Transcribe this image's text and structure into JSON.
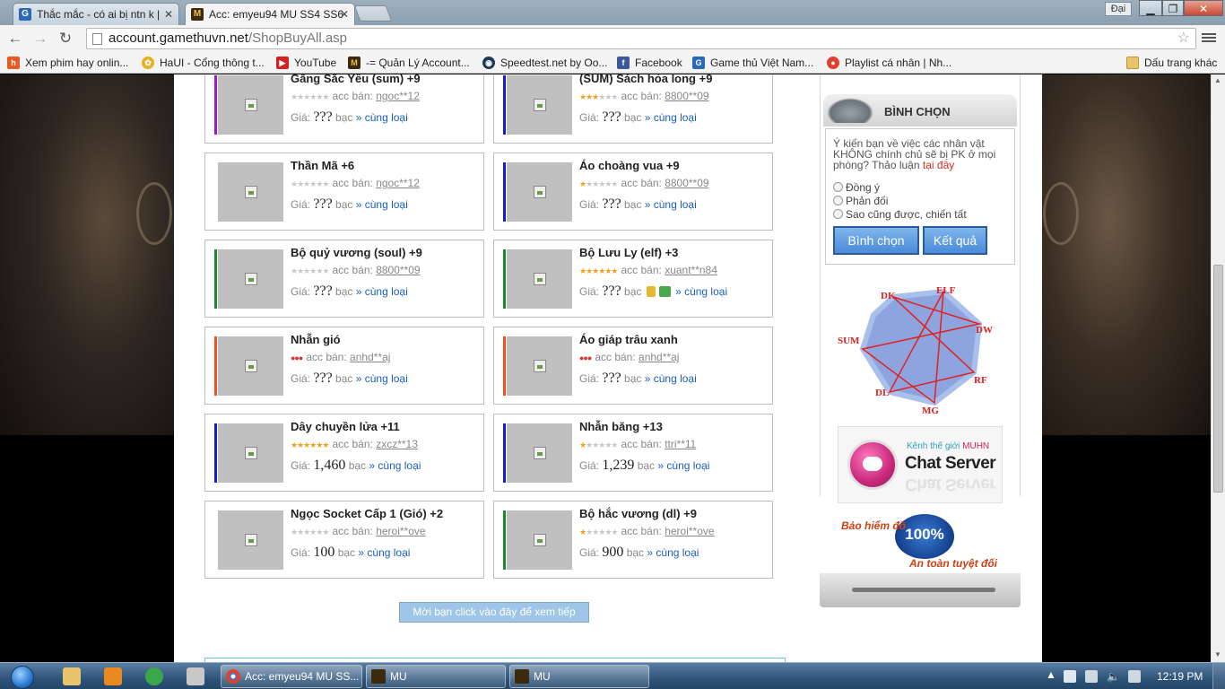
{
  "browser": {
    "tabs": [
      {
        "label": "Thắc mắc - có ai bị ntn k |",
        "active": false
      },
      {
        "label": "Acc: emyeu94 MU SS4 SS6",
        "active": true
      }
    ],
    "user_badge": "Đại",
    "url_host": "account.gamethuvn.net",
    "url_path": "/ShopBuyAll.asp",
    "bookmarks": [
      "Xem phim hay onlin...",
      "HaUI - Cổng thông t...",
      "YouTube",
      "-= Quản Lý Account...",
      "Speedtest.net by Oo...",
      "Facebook",
      "Game thủ Việt Nam...",
      "Playlist cá nhân | Nh...",
      "Dấu trang khác"
    ]
  },
  "items": [
    {
      "name": "Găng Sắc Yêu (sum) +9",
      "stars": 0,
      "seller": "ngoc**12",
      "price": "???",
      "accent": "#9a1ad0"
    },
    {
      "name": "(SUM) Sách hỏa long +9",
      "stars": 3,
      "seller": "8800**09",
      "price": "???",
      "accent": "#1020d0"
    },
    {
      "name": "Thần Mã +6",
      "stars": 0,
      "seller": "ngoc**12",
      "price": "???",
      "accent": ""
    },
    {
      "name": "Áo choàng vua +9",
      "stars": 1,
      "seller": "8800**09",
      "price": "???",
      "accent": "#1020d0"
    },
    {
      "name": "Bộ quỷ vương (soul) +9",
      "stars": 0,
      "seller": "8800**09",
      "price": "???",
      "accent": "#1a8a2a"
    },
    {
      "name": "Bộ Lưu Ly (elf) +3",
      "stars": 6,
      "seller": "xuant**n84",
      "price": "???",
      "accent": "#1a8a2a"
    },
    {
      "name": "Nhẫn gió",
      "stars": -1,
      "seller": "anhd**aj",
      "price": "???",
      "accent": "#f05020"
    },
    {
      "name": "Áo giáp trâu xanh",
      "stars": -1,
      "seller": "anhd**aj",
      "price": "???",
      "accent": "#f05020"
    },
    {
      "name": "Dây chuyền lửa +11",
      "stars": 6,
      "seller": "zxcz**13",
      "price": "1,460",
      "accent": "#1020d0"
    },
    {
      "name": "Nhẫn băng +13",
      "stars": 1,
      "seller": "ttri**11",
      "price": "1,239",
      "accent": "#1020d0"
    },
    {
      "name": "Ngọc Socket Cấp 1 (Gió) +2",
      "stars": 0,
      "seller": "heroi**ove",
      "price": "100",
      "accent": ""
    },
    {
      "name": "Bộ hắc vương (dl) +9",
      "stars": 1,
      "seller": "heroi**ove",
      "price": "900",
      "accent": "#1a8a2a"
    }
  ],
  "labels": {
    "seller_prefix": "acc bán:",
    "price_prefix": "Giá:",
    "currency": "bạc",
    "same_type": "» cùng loại",
    "more": "Mời bạn click vào đây để xem tiếp"
  },
  "vote": {
    "title": "BÌNH CHỌN",
    "question": "Ý kiến bạn về việc các nhân vật KHÔNG chính chủ sẽ bị PK ở mọi phòng? Thảo luận",
    "link": "tại đây",
    "options": [
      "Đồng ý",
      "Phản đối",
      "Sao cũng được, chiến tất"
    ],
    "vote_button": "Bình chọn",
    "result_button": "Kết quả"
  },
  "class_chart": {
    "labels": [
      "DK",
      "ELF",
      "DW",
      "RF",
      "MG",
      "DL",
      "SUM"
    ]
  },
  "chat": {
    "small_prefix": "Kênh thế giới",
    "small_brand": "MUHN",
    "title": "Chat Server"
  },
  "insurance": {
    "line1": "Bảo hiểm đồ",
    "seal": "100%",
    "line2": "An toàn tuyệt đối"
  },
  "taskbar": {
    "tasks": [
      "Acc: emyeu94 MU SS...",
      "MU",
      "MU"
    ],
    "clock": "12:19 PM"
  }
}
